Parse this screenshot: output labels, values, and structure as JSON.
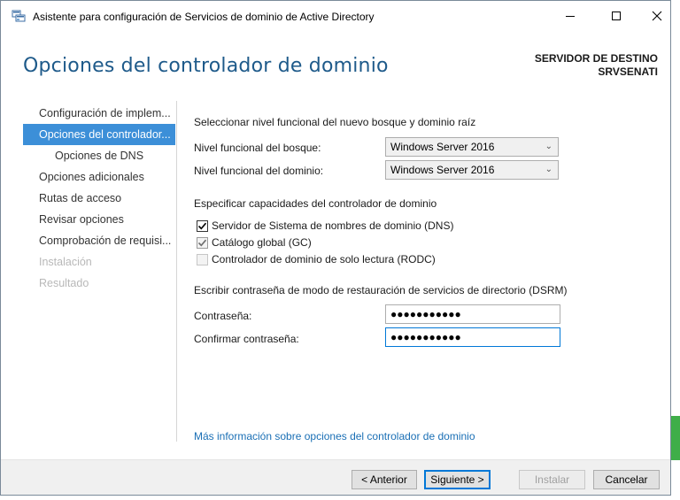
{
  "window": {
    "title": "Asistente para configuración de Servicios de dominio de Active Directory"
  },
  "header": {
    "title": "Opciones del controlador de dominio",
    "dest_label": "SERVIDOR DE DESTINO",
    "dest_server": "SRVSENATI"
  },
  "nav": {
    "items": [
      {
        "label": "Configuración de implem...",
        "state": "normal"
      },
      {
        "label": "Opciones del controlador...",
        "state": "active"
      },
      {
        "label": "Opciones de DNS",
        "state": "sub"
      },
      {
        "label": "Opciones adicionales",
        "state": "normal"
      },
      {
        "label": "Rutas de acceso",
        "state": "normal"
      },
      {
        "label": "Revisar opciones",
        "state": "normal"
      },
      {
        "label": "Comprobación de requisi...",
        "state": "normal"
      },
      {
        "label": "Instalación",
        "state": "disabled"
      },
      {
        "label": "Resultado",
        "state": "disabled"
      }
    ]
  },
  "functional": {
    "heading": "Seleccionar nivel funcional del nuevo bosque y dominio raíz",
    "forest_label": "Nivel funcional del bosque:",
    "forest_value": "Windows Server 2016",
    "domain_label": "Nivel funcional del dominio:",
    "domain_value": "Windows Server 2016"
  },
  "capabilities": {
    "heading": "Especificar capacidades del controlador de dominio",
    "dns_label": "Servidor de Sistema de nombres de dominio (DNS)",
    "dns_checked": true,
    "gc_label": "Catálogo global (GC)",
    "gc_checked": true,
    "rodc_label": "Controlador de dominio de solo lectura (RODC)",
    "rodc_checked": false
  },
  "dsrm": {
    "heading": "Escribir contraseña de modo de restauración de servicios de directorio (DSRM)",
    "password_label": "Contraseña:",
    "password_value": "●●●●●●●●●●●",
    "confirm_label": "Confirmar contraseña:",
    "confirm_value": "●●●●●●●●●●●"
  },
  "more_info_link": "Más información sobre opciones del controlador de dominio",
  "buttons": {
    "back": "< Anterior",
    "next": "Siguiente >",
    "install": "Instalar",
    "cancel": "Cancelar"
  },
  "colors": {
    "accent": "#3c8fd8",
    "header_blue": "#1e5a8a",
    "link_blue": "#1a6fb5"
  }
}
